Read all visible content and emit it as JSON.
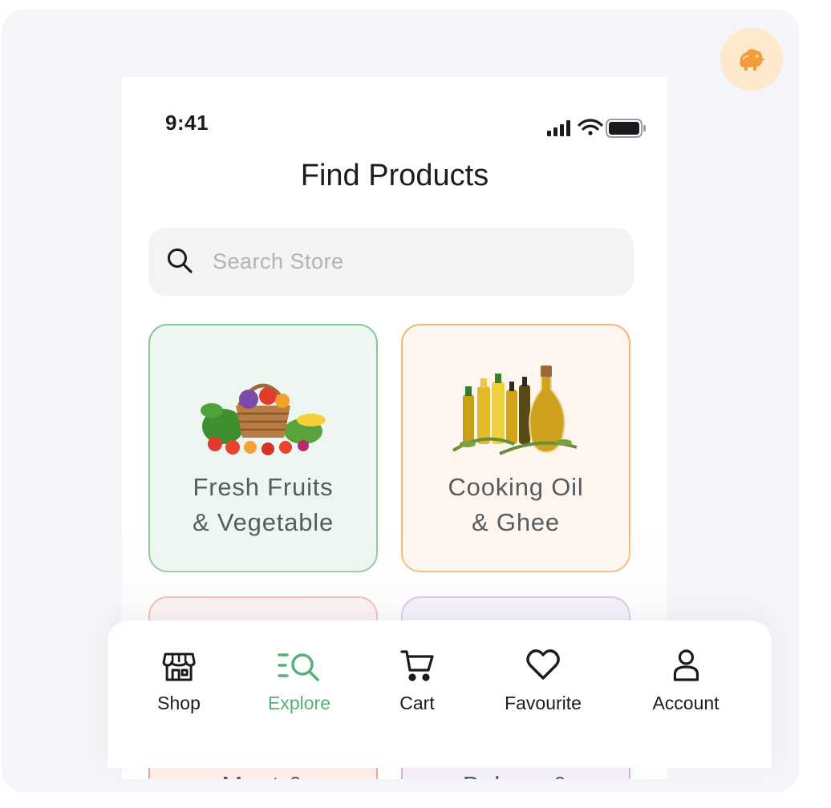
{
  "status_bar": {
    "time": "9:41"
  },
  "header": {
    "title": "Find Products"
  },
  "search": {
    "placeholder": "Search Store",
    "value": ""
  },
  "categories": [
    {
      "line1": "Fresh Fruits",
      "line2": "& Vegetable",
      "background": "#edf6f0",
      "border": "#86c79a"
    },
    {
      "line1": "Cooking Oil",
      "line2": "& Ghee",
      "background": "#fef6ee",
      "border": "#f1b874"
    },
    {
      "line1": "Meat &",
      "line2": "",
      "background": "#fdeee9",
      "border": "#f0a999"
    },
    {
      "line1": "Bakery &",
      "line2": "",
      "background": "#f4eef9",
      "border": "#d2b4ea"
    }
  ],
  "bottom_nav": {
    "items": [
      {
        "label": "Shop",
        "icon": "shop-icon",
        "active": false
      },
      {
        "label": "Explore",
        "icon": "explore-icon",
        "active": true
      },
      {
        "label": "Cart",
        "icon": "cart-icon",
        "active": false
      },
      {
        "label": "Favourite",
        "icon": "heart-icon",
        "active": false
      },
      {
        "label": "Account",
        "icon": "account-icon",
        "active": false
      }
    ]
  },
  "colors": {
    "accent": "#53b175",
    "text": "#1b1b1f",
    "muted": "#b2b3b5",
    "brand_badge": "#fde9cc",
    "brand_icon": "#f39c3a"
  }
}
